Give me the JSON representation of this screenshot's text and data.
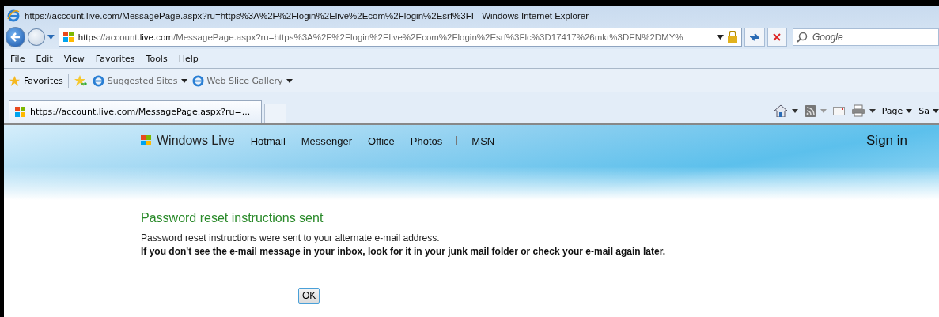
{
  "window": {
    "title": "https://account.live.com/MessagePage.aspx?ru=https%3A%2F%2Flogin%2Elive%2Ecom%2Flogin%2Esrf%3FI - Windows Internet Explorer"
  },
  "address_bar": {
    "url_parts": [
      {
        "text": "https",
        "strong": true
      },
      {
        "text": "://account.",
        "strong": false
      },
      {
        "text": "live.com",
        "strong": true
      },
      {
        "text": "/MessagePage.aspx?ru=https%3A%2F%2Flogin%2Elive%2Ecom%2Flogin%2Esrf%3Flc%3D17417%26mkt%3DEN%2DMY%",
        "strong": false
      }
    ]
  },
  "search": {
    "placeholder": "Google"
  },
  "menu": [
    "File",
    "Edit",
    "View",
    "Favorites",
    "Tools",
    "Help"
  ],
  "favorites_bar": {
    "label": "Favorites",
    "links": [
      {
        "label": "Suggested Sites"
      },
      {
        "label": "Web Slice Gallery"
      }
    ]
  },
  "tabs": [
    {
      "label": "https://account.live.com/MessagePage.aspx?ru=...",
      "selected": true
    }
  ],
  "command_bar": [
    {
      "kind": "home"
    },
    {
      "kind": "feeds"
    },
    {
      "kind": "mail"
    },
    {
      "kind": "print"
    },
    {
      "kind": "menu",
      "label": "Page"
    },
    {
      "kind": "menu",
      "label": "Sa"
    }
  ],
  "page": {
    "brand": "Windows Live",
    "links": [
      {
        "label": "Hotmail"
      },
      {
        "label": "Messenger"
      },
      {
        "label": "Office"
      },
      {
        "label": "Photos"
      },
      {
        "label": "MSN"
      }
    ],
    "sign_in": "Sign in",
    "heading": "Password reset instructions sent",
    "message": "Password reset instructions were sent to your alternate e-mail address.",
    "note": "If you don't see the e-mail message in your inbox, look for it in your junk mail folder or check your e-mail again later.",
    "button": "OK"
  }
}
